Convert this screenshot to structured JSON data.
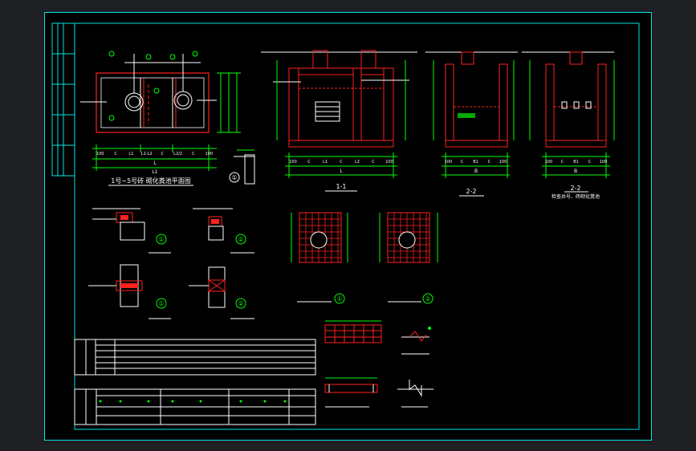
{
  "titles": {
    "plan": "1号~5号砖 砌化粪池平面图",
    "section_11": "1-1",
    "section_22a": "2-2",
    "section_22b": "2-2",
    "section_22b_note": "检查井号、砖砌化粪池",
    "detail1": "①",
    "detail2": "②",
    "detail3": "①",
    "detail4": "②",
    "rebar1": "①",
    "rebar2": "②",
    "small_detail": "①"
  },
  "dims": {
    "plan_bottom": [
      "100",
      "C",
      "L1",
      "L1-L2",
      "C",
      "L2/2",
      "C",
      "100"
    ],
    "plan_total": "L",
    "plan_total2": "L1",
    "sec11_bottom": [
      "100",
      "C",
      "L1",
      "C",
      "L2",
      "C",
      "100"
    ],
    "sec11_total": "L",
    "sec22_bottom": [
      "100",
      "C",
      "B1",
      "C",
      "100"
    ],
    "sec22_total": "B"
  },
  "colors": {
    "frame": "#00e5e5",
    "lines": "#ffffff",
    "dims": "#00ff00",
    "walls": "#ff2020"
  }
}
